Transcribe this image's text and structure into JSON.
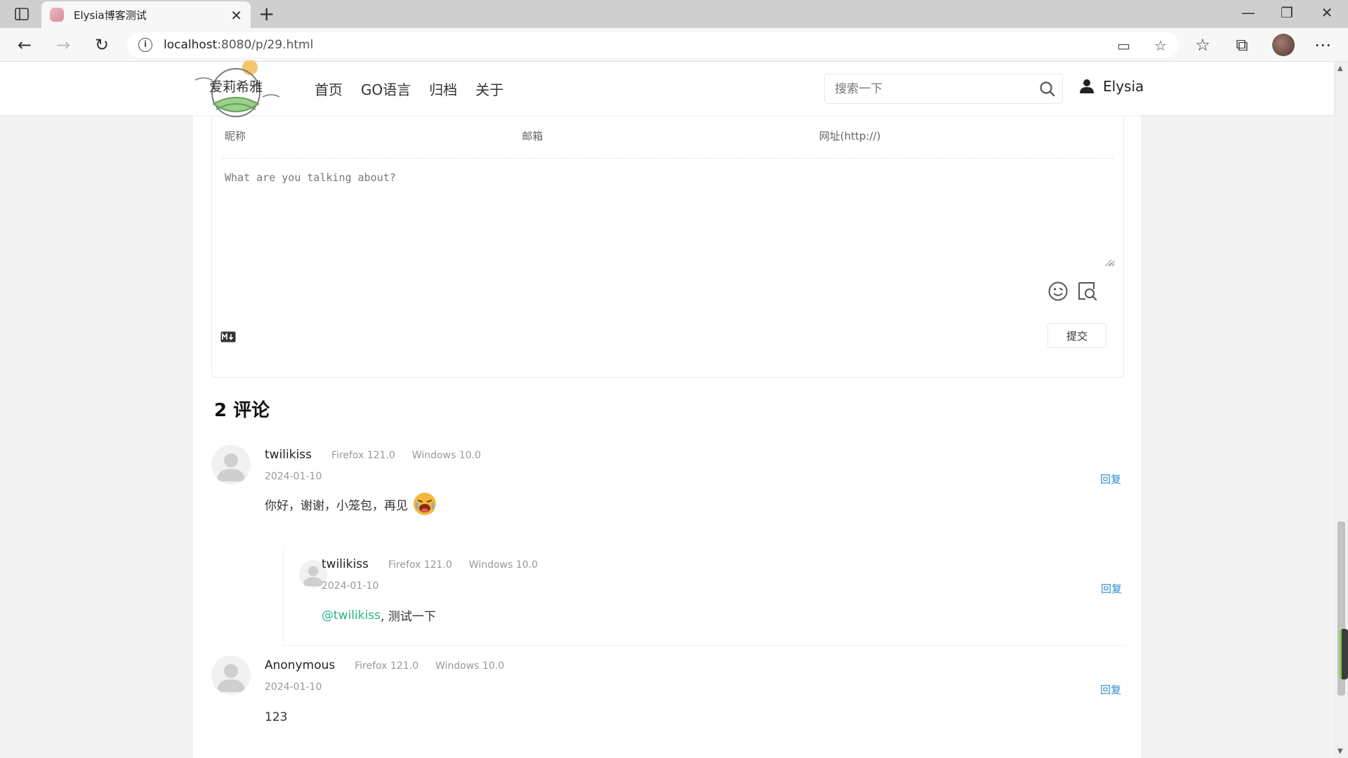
{
  "browser": {
    "tab_title": "Elysia博客测试",
    "url_host": "localhost",
    "url_rest": ":8080/p/29.html"
  },
  "site": {
    "logo_text": "爱莉希雅",
    "nav": [
      "首页",
      "GO语言",
      "归档",
      "关于"
    ],
    "search_placeholder": "搜索一下",
    "user_name": "Elysia"
  },
  "form": {
    "nick_placeholder": "昵称",
    "email_placeholder": "邮箱",
    "url_placeholder": "网址(http://)",
    "textarea_placeholder": "What are you talking about?",
    "submit_label": "提交"
  },
  "comments_header": "2 评论",
  "comments": [
    {
      "nick": "twilikiss",
      "browser": "Firefox 121.0",
      "os": "Windows 10.0",
      "date": "2024-01-10",
      "text": "你好，谢谢，小笼包，再见",
      "reply_label": "回复"
    },
    {
      "nick": "twilikiss",
      "browser": "Firefox 121.0",
      "os": "Windows 10.0",
      "date": "2024-01-10",
      "at": "@twilikiss",
      "text": " , 测试一下",
      "reply_label": "回复"
    },
    {
      "nick": "Anonymous",
      "browser": "Firefox 121.0",
      "os": "Windows 10.0",
      "date": "2024-01-10",
      "text": "123",
      "reply_label": "回复"
    }
  ],
  "colors": {
    "link": "#2f8fd8",
    "at_link": "#27b48b"
  }
}
